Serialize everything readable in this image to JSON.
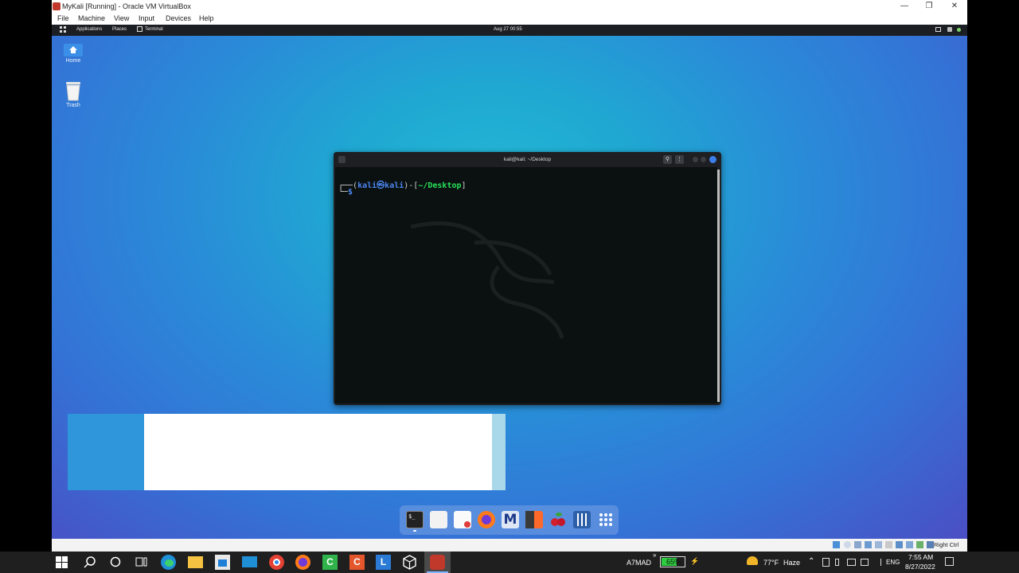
{
  "window": {
    "title": "MyKali [Running] - Oracle VM VirtualBox",
    "minimize_icon": "minimize-icon",
    "maximize_icon": "restore-icon",
    "close_icon": "close-icon"
  },
  "menubar": {
    "items": [
      "File",
      "Machine",
      "View",
      "Input",
      "Devices",
      "Help"
    ]
  },
  "guest_panel": {
    "applications": "Applications",
    "places": "Places",
    "terminal_task": "Terminal",
    "clock": "Aug 27  00:55"
  },
  "desktop_icons": [
    {
      "label": "Home",
      "icon": "home-folder-icon"
    },
    {
      "label": "Trash",
      "icon": "trash-icon"
    }
  ],
  "terminal": {
    "title": "kali@kali: ~/Desktop",
    "prompt_open": "┌──(",
    "prompt_user": "kali㉿kali",
    "prompt_mid": ")-[",
    "prompt_path": "~/Desktop",
    "prompt_close": "]",
    "prompt_line2": "└─",
    "prompt_symbol": "$"
  },
  "dock": {
    "items": [
      "terminal-icon",
      "file-manager-icon",
      "text-editor-icon",
      "firefox-icon",
      "metasploit-icon",
      "burpsuite-icon",
      "cherrytree-icon",
      "settings-icon",
      "app-grid-icon"
    ]
  },
  "vbox_status": {
    "host_key": "Right Ctrl"
  },
  "taskbar": {
    "network_name": "A7MAD",
    "battery": "65%",
    "weather_temp": "77°F",
    "weather_cond": "Haze",
    "language": "ENG",
    "time": "7:55 AM",
    "date": "8/27/2022",
    "apps": [
      "start-icon",
      "search-icon",
      "cortana-icon",
      "task-view-icon",
      "edge-icon",
      "file-explorer-icon",
      "store-icon",
      "mail-icon",
      "chrome-icon",
      "firefox-icon",
      "camtasia-icon",
      "camtasia-rec-icon",
      "lens-icon",
      "virtualbox-icon",
      "vbox-vm-icon"
    ]
  },
  "colors": {
    "prompt_blue": "#3f7ef0",
    "prompt_green": "#27e35a",
    "battery_green": "#2ecc40"
  }
}
